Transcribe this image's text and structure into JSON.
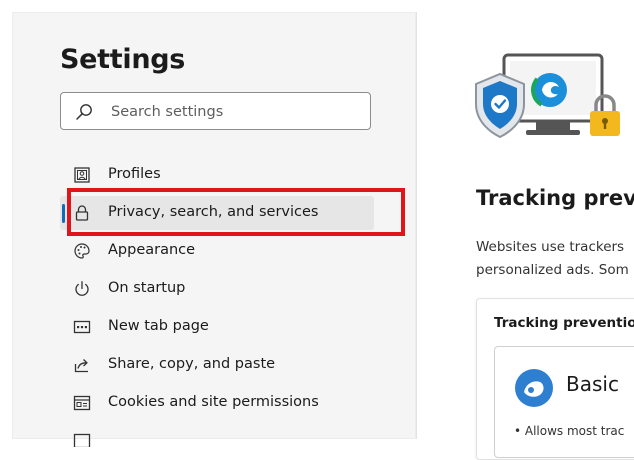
{
  "sidebar": {
    "title": "Settings",
    "search": {
      "placeholder": "Search settings",
      "value": ""
    },
    "items": [
      {
        "label": "Profiles",
        "icon": "profile-icon",
        "selected": false
      },
      {
        "label": "Privacy, search, and services",
        "icon": "lock-icon",
        "selected": true
      },
      {
        "label": "Appearance",
        "icon": "palette-icon",
        "selected": false
      },
      {
        "label": "On startup",
        "icon": "power-icon",
        "selected": false
      },
      {
        "label": "New tab page",
        "icon": "new-tab-icon",
        "selected": false
      },
      {
        "label": "Share, copy, and paste",
        "icon": "share-icon",
        "selected": false
      },
      {
        "label": "Cookies and site permissions",
        "icon": "cookies-icon",
        "selected": false
      }
    ]
  },
  "main": {
    "title": "Tracking preve",
    "description_lines": [
      "Websites use trackers",
      "personalized ads. Som"
    ],
    "card_title": "Tracking preventio",
    "option": {
      "label": "Basic",
      "bullet": "•  Allows most trac"
    }
  },
  "colors": {
    "accent": "#0f6cbd",
    "highlight_border": "#e0151c",
    "sidebar_bg": "#f5f5f5"
  }
}
